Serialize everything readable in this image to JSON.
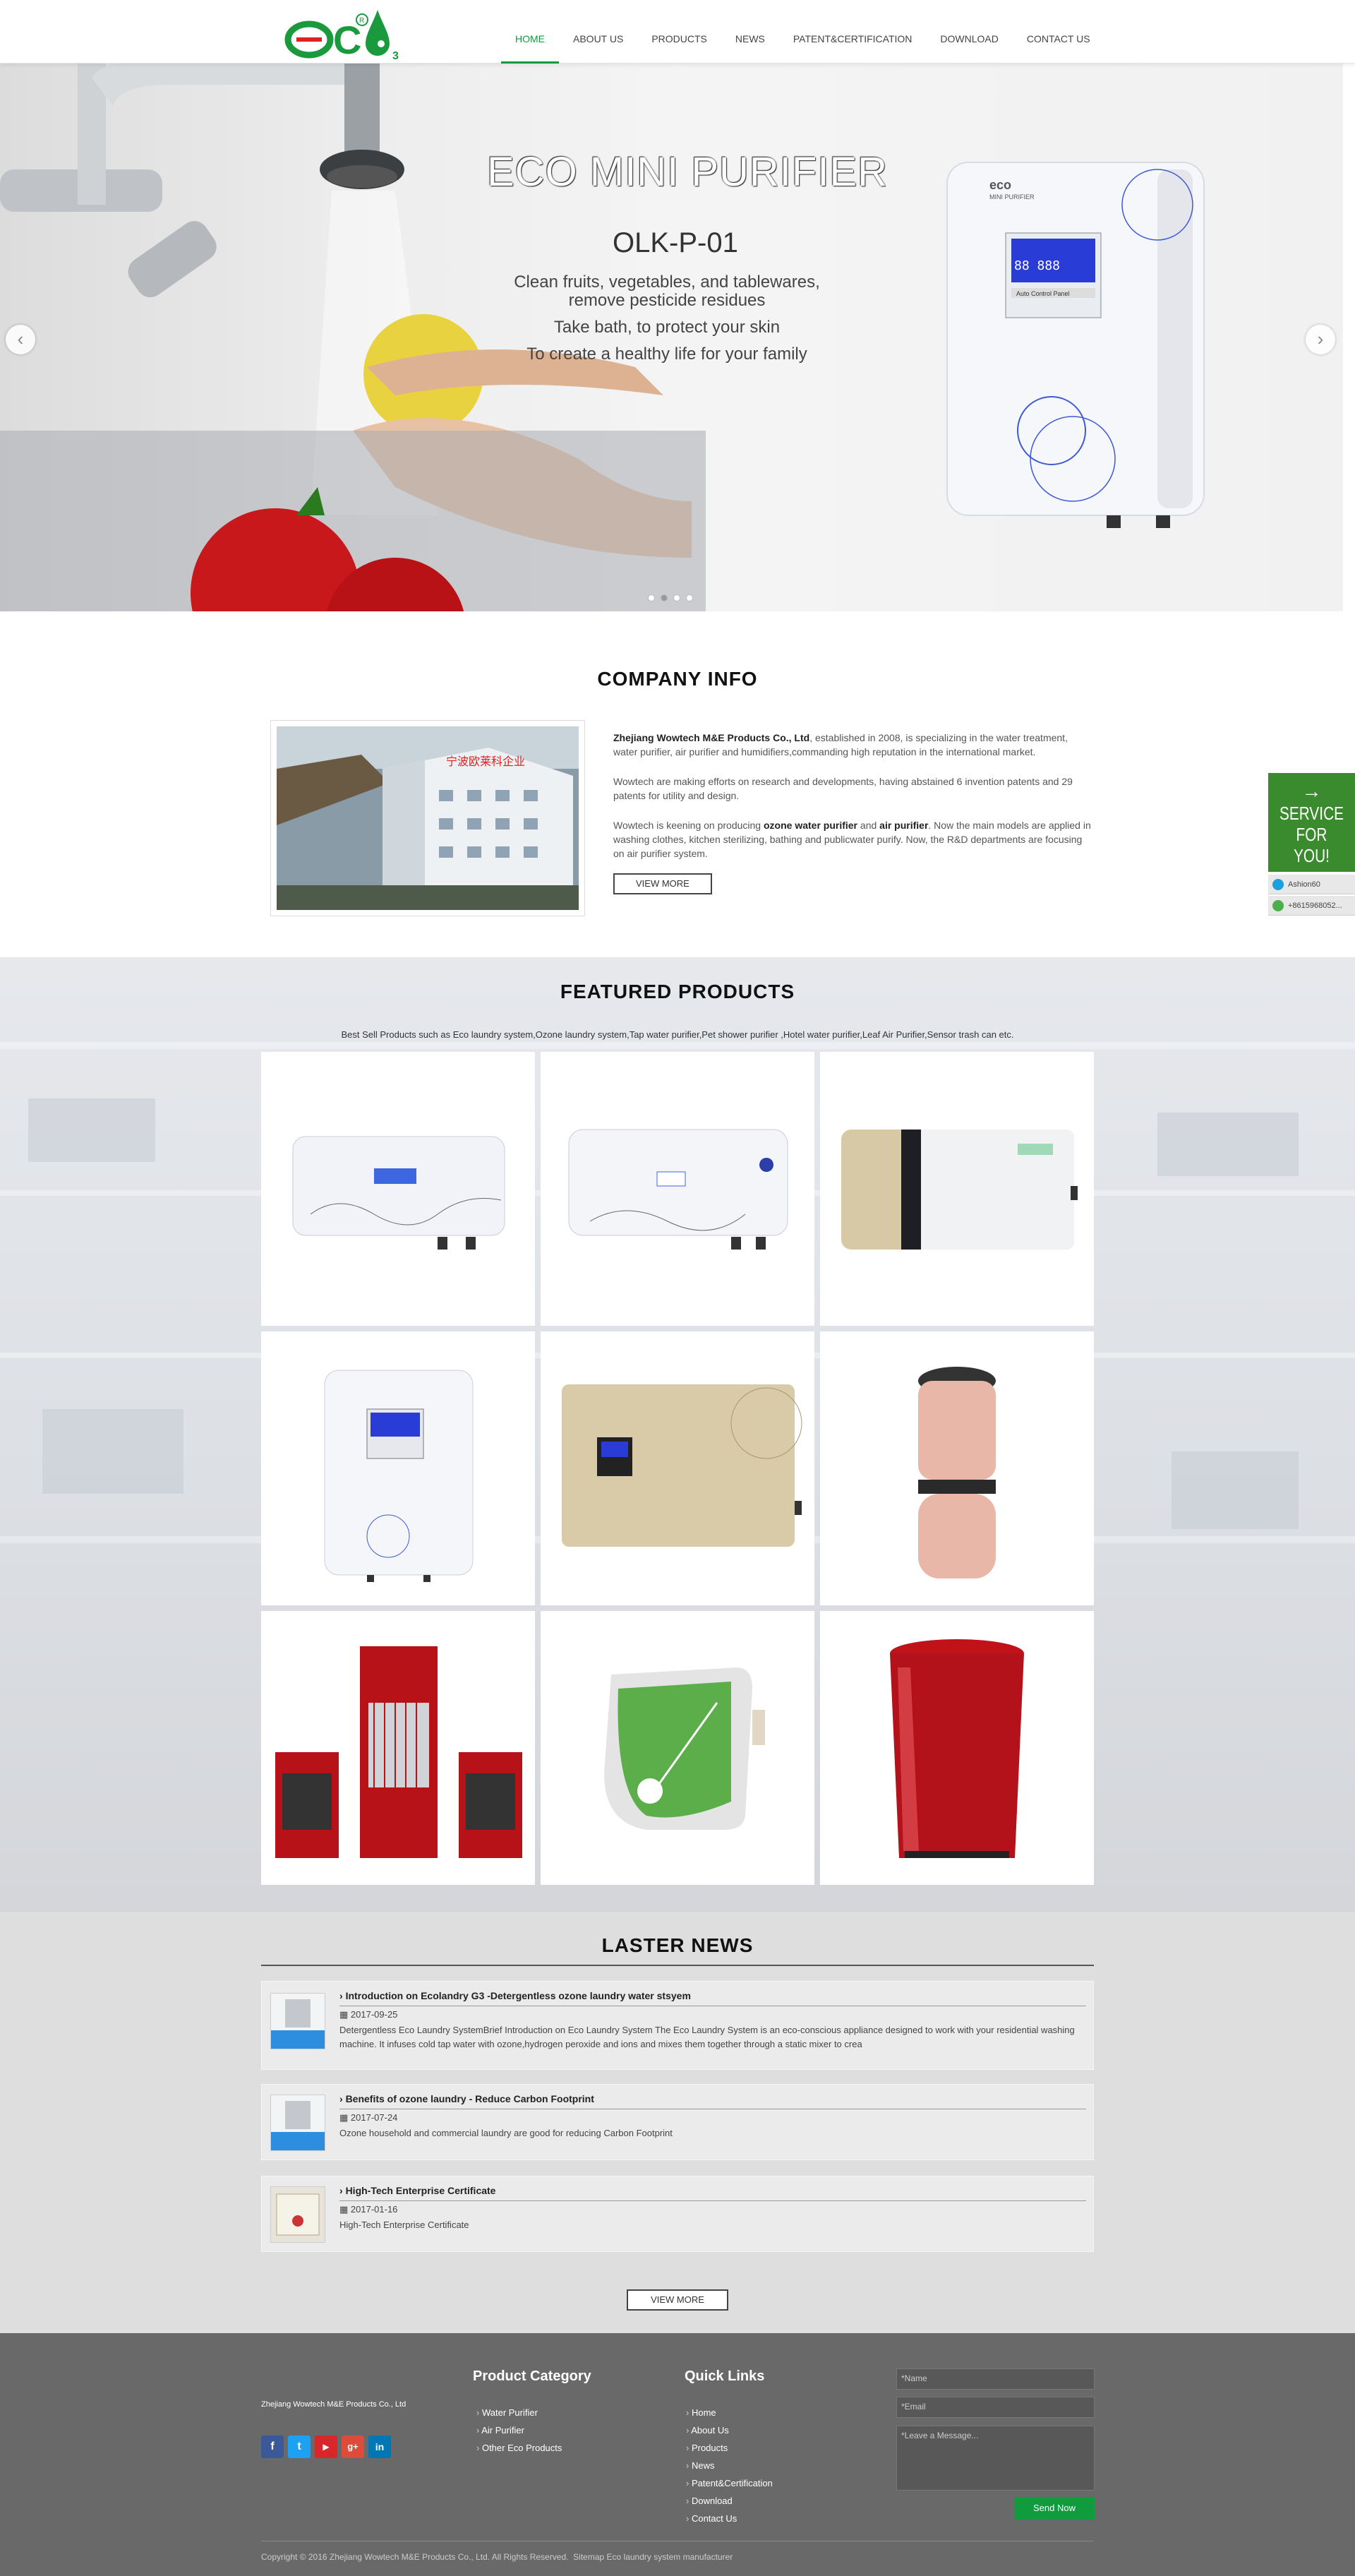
{
  "header": {
    "logo_alt": "ECO",
    "nav": [
      "HOME",
      "ABOUT US",
      "PRODUCTS",
      "NEWS",
      "PATENT&CERTIFICATION",
      "DOWNLOAD",
      "CONTACT US"
    ],
    "active": "HOME"
  },
  "banner": {
    "title": "ECO MINI PURIFIER",
    "model": "OLK-P-01",
    "lines": [
      "Clean fruits, vegetables, and tablewares,",
      "remove pesticide residues",
      "Take bath, to protect your skin",
      "To create a healthy life for your family"
    ],
    "device_panel_label": "Auto Control Panel",
    "device_brand": "MINI PURIFIER",
    "prev": "‹",
    "next": "›",
    "slide_count": 4,
    "active_slide": 2
  },
  "company": {
    "title": "COMPANY INFO",
    "p1_name": "Zhejiang Wowtech M&E Products Co., Ltd",
    "p1_rest": ", established in 2008, is specializing in the water treatment, water purifier, air purifier and humidifiers,commanding high reputation in the international market.",
    "p2": "Wowtech are making efforts on research and developments, having abstained 6 invention patents and 29 patents for utility and design.",
    "p3_a": "Wowtech is keening on producing ",
    "p3_b": "ozone water purifier",
    "p3_c": " and ",
    "p3_d": "air purifier",
    "p3_e": ". Now the main models are applied in washing clothes, kitchen sterilizing, bathing and publicwater purify. Now, the R&D departments are focusing on air purifier system.",
    "view_more": "VIEW MORE",
    "sign_text": "宁波欧莱科企业"
  },
  "featured": {
    "title": "FEATURED PRODUCTS",
    "subtitle": "Best Sell Products such as Eco laundry system,Ozone laundry system,Tap water purifier,Pet shower purifier ,Hotel water purifier,Leaf Air Purifier,Sensor trash can etc."
  },
  "news": {
    "title": "LASTER NEWS",
    "items": [
      {
        "title": "Introduction on Ecolandry G3 -Detergentless ozone laundry water stsyem",
        "date": "2017-09-25",
        "desc": "Detergentless Eco Laundry SystemBrief Introduction on Eco Laundry System The Eco Laundry System is an eco-conscious appliance designed to work with your residential washing machine. It infuses cold tap water with ozone,hydrogen peroxide and ions and mixes them together through a static mixer to crea"
      },
      {
        "title": "Benefits of ozone laundry - Reduce Carbon Footprint",
        "date": "2017-07-24",
        "desc": "Ozone household and commercial laundry are good for reducing Carbon Footprint"
      },
      {
        "title": "High-Tech Enterprise Certificate",
        "date": "2017-01-16",
        "desc": "High-Tech Enterprise Certificate"
      }
    ],
    "view_more": "VIEW MORE"
  },
  "footer": {
    "company": "Zhejiang Wowtech M&E Products Co., Ltd",
    "social": [
      "f",
      "t",
      "▶",
      "g+",
      "in"
    ],
    "product_category_title": "Product Category",
    "product_categories": [
      "Water Purifier",
      "Air Purifier",
      "Other Eco Products"
    ],
    "quick_links_title": "Quick Links",
    "quick_links": [
      "Home",
      "About Us",
      "Products",
      "News",
      "Patent&Certification",
      "Download",
      "Contact Us"
    ],
    "name_placeholder": "*Name",
    "email_placeholder": "*Email",
    "message_placeholder": "*Leave a Message...",
    "send": "Send Now",
    "copyright": "Copyright © 2016 Zhejiang Wowtech M&E Products Co., Ltd. All Rights Reserved.",
    "bottom_links": "Sitemap  Eco laundry system manufacturer"
  },
  "service": {
    "arrow": "→",
    "line1": "SERVICE",
    "line2": "FOR YOU!",
    "skype": "Ashion60",
    "phone": "+8615968052..."
  }
}
